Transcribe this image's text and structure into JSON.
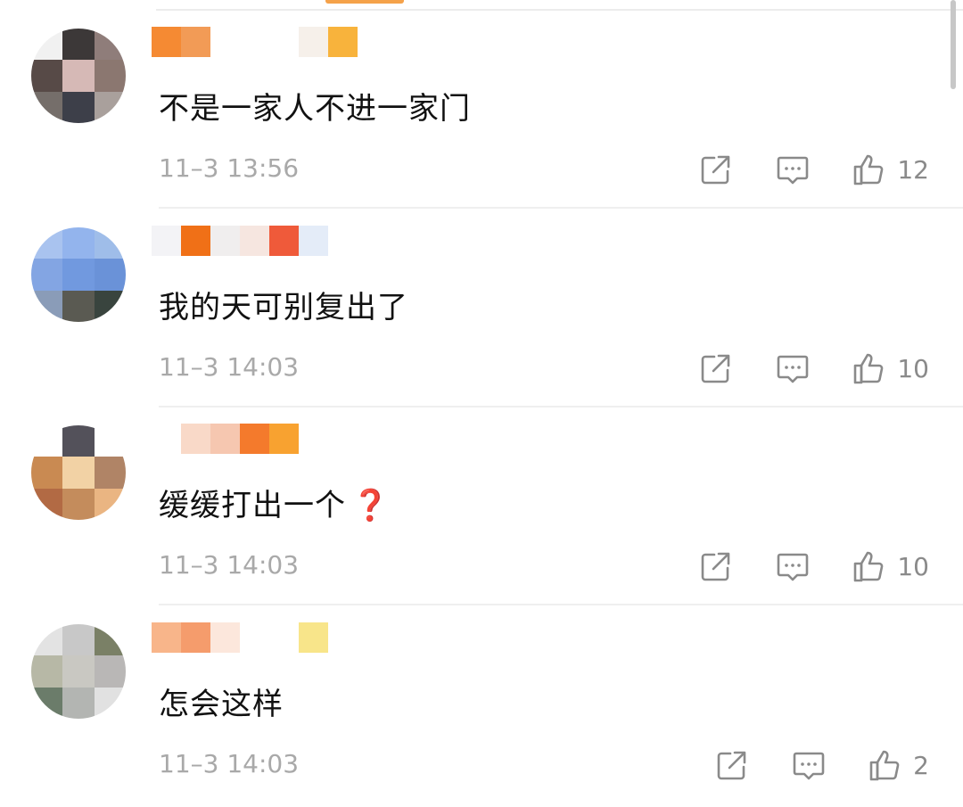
{
  "comments": [
    {
      "username": "",
      "text": "不是一家人不进一家门",
      "time": "11–3 13:56",
      "likes": "12",
      "avatar_colors": [
        "#f1f1f1",
        "#3c3838",
        "#8f7d7a",
        "#574a47",
        "#d6b9b6",
        "#8b7770",
        "#756e6a",
        "#3d3f49",
        "#a9a09c"
      ],
      "name_colors": [
        "#f58a33",
        "#f29b56",
        "#ffffff",
        "#ffffff",
        "#ffffff",
        "#f6f0ea",
        "#f8b33c"
      ]
    },
    {
      "username": "",
      "text": "我的天可别复出了",
      "time": "11–3 14:03",
      "likes": "10",
      "avatar_colors": [
        "#a9c3ef",
        "#93b4ed",
        "#9fbde9",
        "#83a5e3",
        "#7199df",
        "#6a92d8",
        "#8a9cb8",
        "#5a5a52",
        "#39443e"
      ],
      "name_colors": [
        "#f3f3f6",
        "#f07017",
        "#f0eeee",
        "#f6e6e0",
        "#ef5a3a",
        "#e4ecf8"
      ]
    },
    {
      "username": "",
      "text": "缓缓打出一个",
      "question_mark": "❓",
      "time": "11–3 14:03",
      "likes": "10",
      "avatar_colors": [
        "#ffffff",
        "#53515a",
        "#ffffff",
        "#c98a52",
        "#f2d2a5",
        "#b08466",
        "#b26a44",
        "#c48c5c",
        "#eab582"
      ],
      "name_colors": [
        "#ffffff",
        "#f9d9c8",
        "#f6c7b0",
        "#f47a2c",
        "#f8a230"
      ]
    },
    {
      "username": "",
      "text": "怎会这样",
      "time": "11–3 14:03",
      "likes": "2",
      "avatar_colors": [
        "#e3e3e3",
        "#c8c8c8",
        "#7a8066",
        "#b7b8a6",
        "#c9c8c2",
        "#b9b7b6",
        "#6b7c6a",
        "#b3b5b2",
        "#e1e1e1"
      ],
      "name_colors": [
        "#f8b58a",
        "#f59c6c",
        "#fce7dc",
        "#ffffff",
        "#ffffff",
        "#f8e58a"
      ]
    }
  ],
  "icons": {
    "share": "share-icon",
    "reply": "comment-icon",
    "like": "thumbs-up-icon"
  },
  "colors": {
    "text": "#111111",
    "meta": "#a9a9a9",
    "icon": "#8a8a8a",
    "question_mark": "#d42626"
  }
}
